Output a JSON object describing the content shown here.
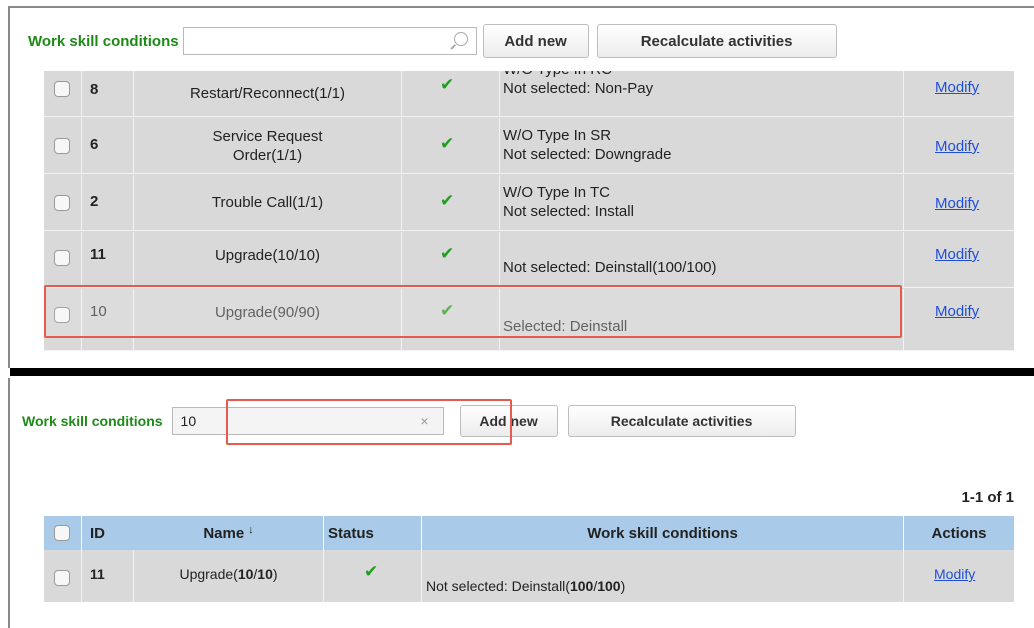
{
  "top": {
    "label": "Work skill conditions",
    "search_value": "",
    "add_new": "Add new",
    "recalculate": "Recalculate activities",
    "rows": [
      {
        "id": "8",
        "name": "Restart/Reconnect(1/1)",
        "status": "✔",
        "cond1": "W/O Type In RC",
        "cond2": "Not selected: Non-Pay",
        "action": "Modify"
      },
      {
        "id": "6",
        "name": "Service Request Order(1/1)",
        "status": "✔",
        "cond1": "W/O Type In SR",
        "cond2": "Not selected: Downgrade",
        "action": "Modify"
      },
      {
        "id": "2",
        "name": "Trouble Call(1/1)",
        "status": "✔",
        "cond1": "W/O Type In TC",
        "cond2": "Not selected: Install",
        "action": "Modify"
      },
      {
        "id": "11",
        "name": "Upgrade(10/10)",
        "status": "✔",
        "cond1": "",
        "cond2": "Not selected: Deinstall(100/100)",
        "action": "Modify"
      },
      {
        "id": "10",
        "name": "Upgrade(90/90)",
        "status": "✔",
        "cond1": "",
        "cond2": "Selected: Deinstall",
        "action": "Modify"
      }
    ]
  },
  "bottom": {
    "label": "Work skill conditions",
    "search_value": "10",
    "clear": "×",
    "add_new": "Add new",
    "recalculate": "Recalculate activities",
    "pager": "1-1 of 1",
    "headers": {
      "id": "ID",
      "name": "Name",
      "sort": "↓",
      "status": "Status",
      "conditions": "Work skill conditions",
      "actions": "Actions"
    },
    "row": {
      "id": "11",
      "name_prefix": "Upgrade(",
      "name_a": "10",
      "name_sep": "/",
      "name_b": "10",
      "name_suffix": ")",
      "status": "✔",
      "cond_prefix": "Not selected: Deinstall(",
      "cond_a": "100",
      "cond_sep": "/",
      "cond_b": "100",
      "cond_suffix": ")",
      "action": "Modify"
    }
  },
  "colors": {
    "label_green": "#1d8a17",
    "header_blue": "#a9cbe9",
    "row_gray": "#d9d9d9",
    "highlight_red": "#e55b50",
    "link_blue": "#1f4fd9",
    "check_green": "#1ea01e"
  },
  "icons": {
    "search": "search-icon",
    "status": "checkmark-icon",
    "clear": "clear-icon"
  }
}
